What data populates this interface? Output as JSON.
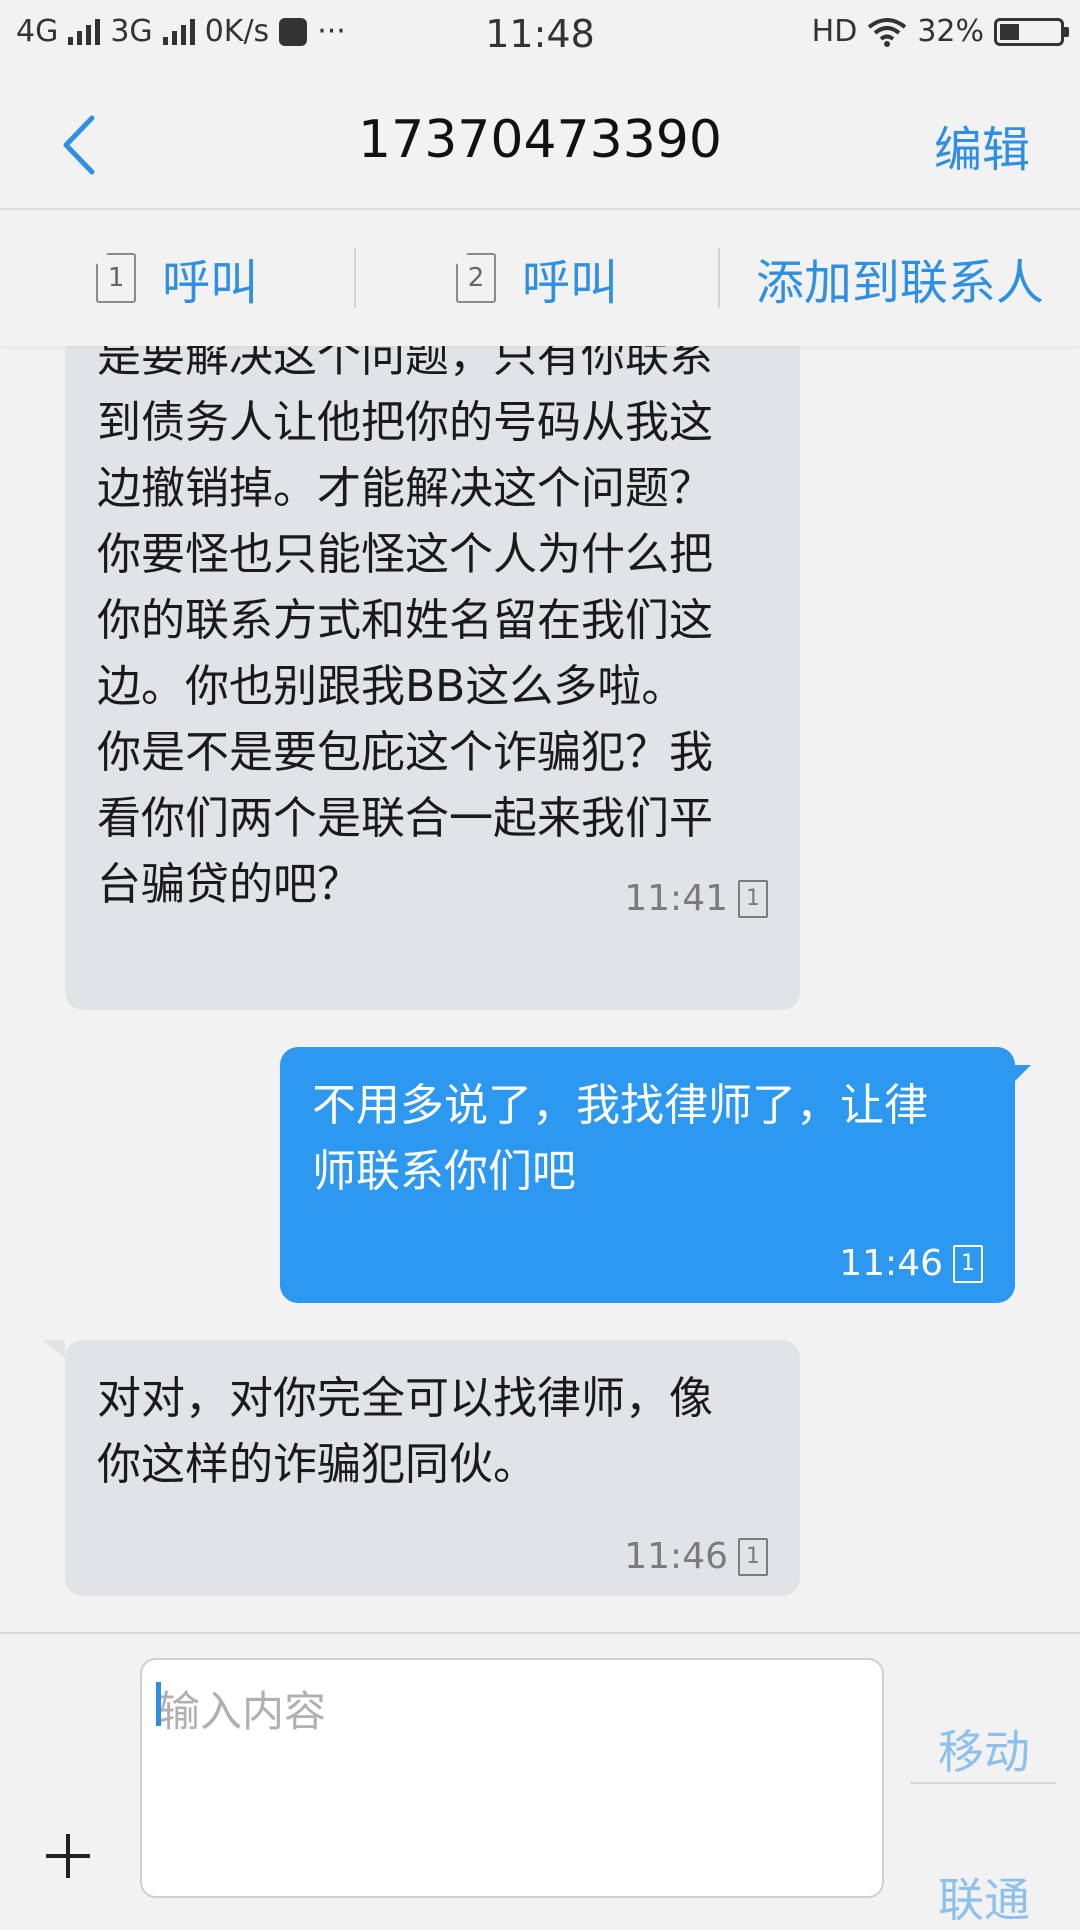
{
  "status_bar": {
    "net1": "4G",
    "net2": "3G",
    "speed": "0K/s",
    "more": "···",
    "time": "11:48",
    "hd": "HD",
    "battery_text": "32%",
    "battery_level": 0.32
  },
  "header": {
    "title": "17370473390",
    "edit_label": "编辑"
  },
  "actions": {
    "call1_label": "呼叫",
    "sim1": "1",
    "call2_label": "呼叫",
    "sim2": "2",
    "add_contact_label": "添加到联系人"
  },
  "messages": [
    {
      "direction": "incoming",
      "text": "是要解决这个问题，只有你联系\n到债务人让他把你的号码从我这\n边撤销掉。才能解决这个问题？\n你要怪也只能怪这个人为什么把\n你的联系方式和姓名留在我们这\n边。你也别跟我BB这么多啦。\n你是不是要包庇这个诈骗犯？我\n看你们两个是联合一起来我们平\n台骗贷的吧？",
      "time": "11:41",
      "sim": "1"
    },
    {
      "direction": "outgoing",
      "text": "不用多说了，我找律师了，让律\n师联系你们吧",
      "time": "11:46",
      "sim": "1"
    },
    {
      "direction": "incoming",
      "text": "对对，对你完全可以找律师，像\n你这样的诈骗犯同伙。",
      "time": "11:46",
      "sim": "1"
    }
  ],
  "input": {
    "placeholder": "输入内容",
    "send1_label": "移动",
    "send2_label": "联通"
  },
  "colors": {
    "accent": "#2f8fe2",
    "outgoing_bubble": "#2c98f0",
    "incoming_bubble": "#e1e3e6"
  }
}
